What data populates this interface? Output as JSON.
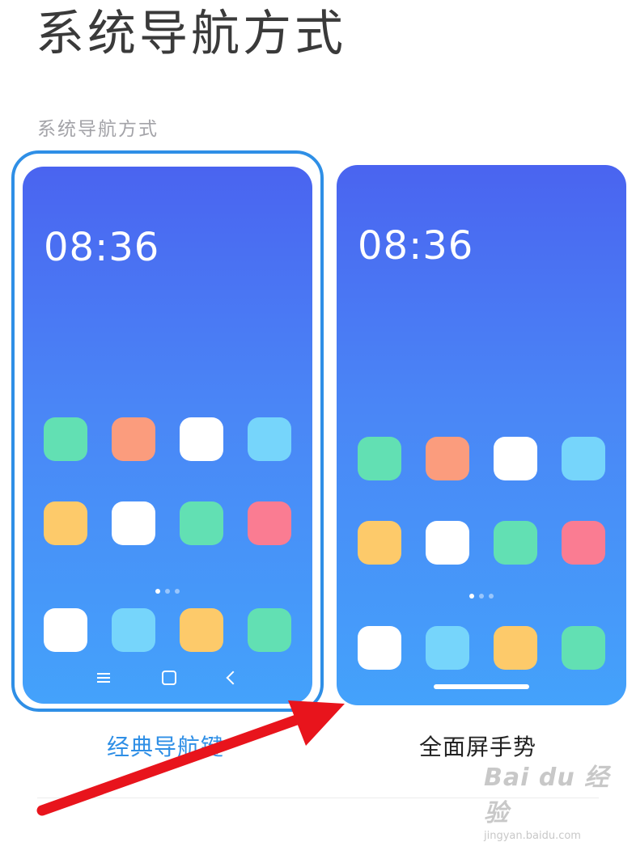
{
  "page_title": "系统导航方式",
  "section_label": "系统导航方式",
  "options": [
    {
      "label": "经典导航键",
      "clock": "08:36",
      "selected": true,
      "nav_icons": [
        "menu-icon",
        "home-icon",
        "back-icon"
      ]
    },
    {
      "label": "全面屏手势",
      "clock": "08:36",
      "selected": false,
      "nav_icons": [
        "gesture-bar"
      ]
    }
  ],
  "app_colors": {
    "row1": [
      "#62e0b3",
      "#fb9c7d",
      "#ffffff",
      "#76d5fb"
    ],
    "row2": [
      "#fdca6a",
      "#ffffff",
      "#62e0b3",
      "#fa7c92"
    ],
    "dock": [
      "#ffffff",
      "#76d5fb",
      "#fdca6a",
      "#62e0b3"
    ]
  },
  "accent_color": "#2f8fe6",
  "annotation_arrow_color": "#e8141c",
  "watermark": {
    "main": "Bai du 经验",
    "sub": "jingyan.baidu.com"
  }
}
